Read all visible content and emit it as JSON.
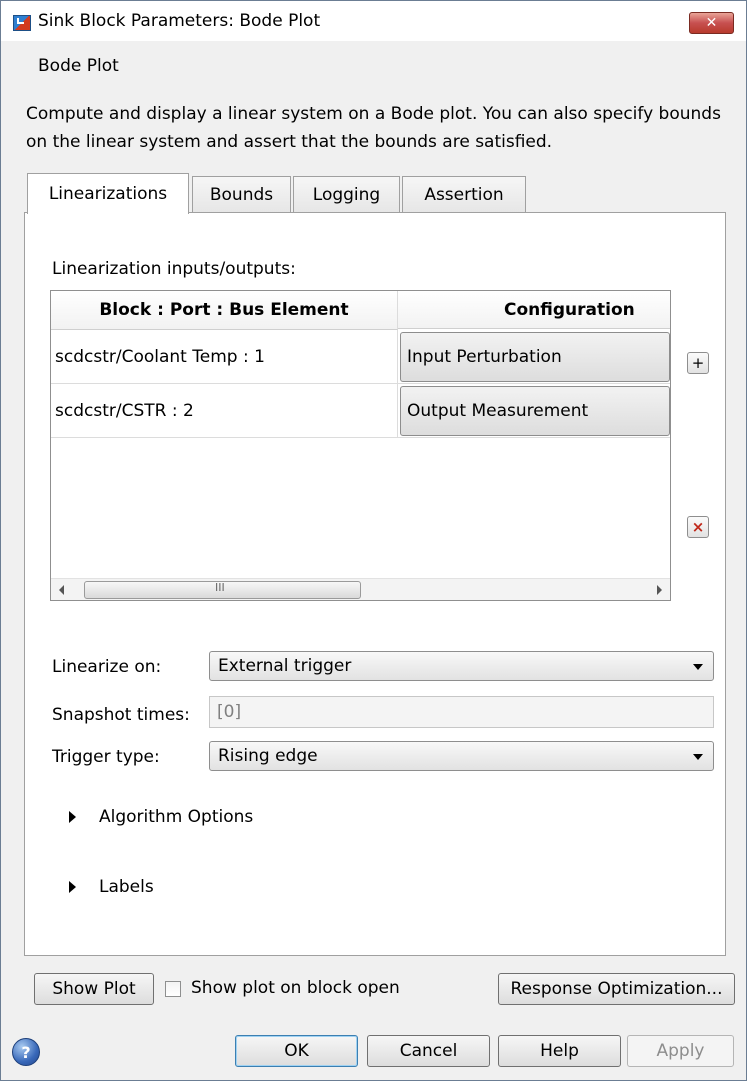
{
  "window": {
    "title": "Sink Block Parameters: Bode Plot",
    "close_symbol": "✕",
    "app_icon": "simulink-block-icon"
  },
  "group_label": "Bode Plot",
  "description": "Compute and display a linear system on a Bode plot. You can also specify bounds on the linear system and assert that the bounds are satisfied.",
  "tabs": [
    {
      "label": "Linearizations",
      "active": true
    },
    {
      "label": "Bounds",
      "active": false
    },
    {
      "label": "Logging",
      "active": false
    },
    {
      "label": "Assertion",
      "active": false
    }
  ],
  "linearization": {
    "label": "Linearization inputs/outputs:",
    "columns": [
      "Block : Port : Bus Element",
      "Configuration"
    ],
    "rows": [
      {
        "block": "scdcstr/Coolant Temp : 1",
        "configuration": "Input Perturbation"
      },
      {
        "block": "scdcstr/CSTR : 2",
        "configuration": "Output Measurement"
      }
    ],
    "add_symbol": "+",
    "remove_symbol": "×"
  },
  "form": {
    "linearize_on_label": "Linearize on:",
    "linearize_on_value": "External trigger",
    "snapshot_label": "Snapshot times:",
    "snapshot_value": "[0]",
    "trigger_label": "Trigger type:",
    "trigger_value": "Rising edge"
  },
  "sections": {
    "algorithm": "Algorithm Options",
    "labels": "Labels"
  },
  "bottom": {
    "show_plot": "Show Plot",
    "show_on_open": "Show plot on block open",
    "response_opt": "Response Optimization...",
    "help_symbol": "?",
    "ok": "OK",
    "cancel": "Cancel",
    "help": "Help",
    "apply": "Apply"
  }
}
